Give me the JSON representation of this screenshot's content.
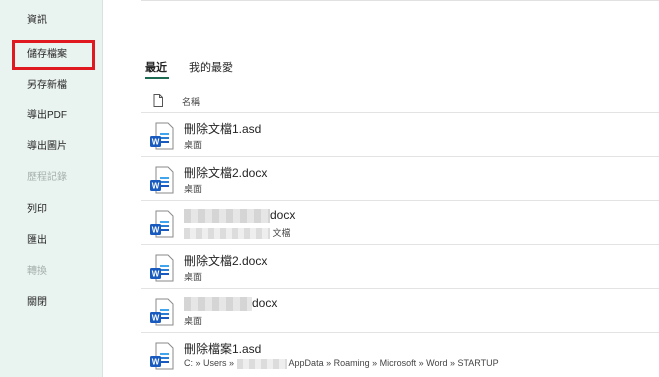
{
  "sidebar": {
    "items": [
      {
        "label": "資訊",
        "disabled": false
      },
      {
        "label": "儲存檔案",
        "disabled": false,
        "highlighted": true
      },
      {
        "label": "另存新檔",
        "disabled": false
      },
      {
        "label": "導出PDF",
        "disabled": false
      },
      {
        "label": "導出圖片",
        "disabled": false
      },
      {
        "label": "歷程記錄",
        "disabled": true
      },
      {
        "label": "列印",
        "disabled": false
      },
      {
        "label": "匯出",
        "disabled": false
      },
      {
        "label": "轉換",
        "disabled": true
      },
      {
        "label": "關閉",
        "disabled": false
      }
    ]
  },
  "tabs": [
    {
      "label": "最近",
      "active": true
    },
    {
      "label": "我的最愛",
      "active": false
    }
  ],
  "list_header": {
    "name_label": "名稱",
    "icon": "file-outline-icon"
  },
  "files": [
    {
      "name": "刪除文檔1.asd",
      "path": "桌面",
      "icon": "word-document-icon"
    },
    {
      "name": "刪除文檔2.docx",
      "path": "桌面",
      "icon": "word-document-icon"
    },
    {
      "name_suffix": "docx",
      "path_suffix": "文檔",
      "icon": "word-document-icon"
    },
    {
      "name": "刪除文檔2.docx",
      "path": "桌面",
      "icon": "word-document-icon"
    },
    {
      "name_suffix": "docx",
      "path": "桌面",
      "icon": "word-document-icon"
    },
    {
      "name": "刪除檔案1.asd",
      "path_prefix": "C: » Users »",
      "path_suffix": "AppData » Roaming » Microsoft » Word » STARTUP",
      "icon": "word-document-icon"
    }
  ],
  "colors": {
    "sidebar_bg": "#e9f3f0",
    "accent": "#1d6a52",
    "highlight_box": "#e0181f",
    "word_blue": "#185abd"
  }
}
